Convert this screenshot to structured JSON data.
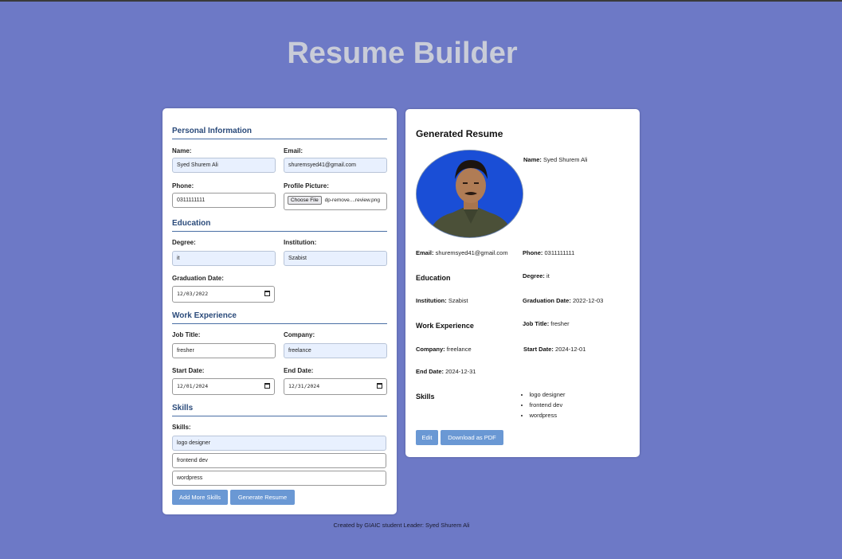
{
  "page": {
    "title": "Resume Builder",
    "footer": "Created by GIAIC student Leader: Syed Shurem Ali"
  },
  "form": {
    "personal": {
      "heading": "Personal Information",
      "name_label": "Name:",
      "name_value": "Syed Shurem Ali",
      "email_label": "Email:",
      "email_value": "shuremsyed41@gmail.com",
      "phone_label": "Phone:",
      "phone_value": "0311111111",
      "picture_label": "Profile Picture:",
      "choose_file": "Choose File",
      "file_name": "dp-remove....review.png"
    },
    "education": {
      "heading": "Education",
      "degree_label": "Degree:",
      "degree_value": "it",
      "institution_label": "Institution:",
      "institution_value": "Szabist",
      "grad_label": "Graduation Date:",
      "grad_value": "12/03/2022"
    },
    "work": {
      "heading": "Work Experience",
      "job_label": "Job Title:",
      "job_value": "fresher",
      "company_label": "Company:",
      "company_value": "freelance",
      "start_label": "Start Date:",
      "start_value": "12/01/2024",
      "end_label": "End Date:",
      "end_value": "12/31/2024"
    },
    "skills": {
      "heading": "Skills",
      "label": "Skills:",
      "values": [
        "logo designer",
        "frontend dev",
        "wordpress"
      ]
    },
    "buttons": {
      "add_skills": "Add More Skills",
      "generate": "Generate Resume"
    }
  },
  "resume": {
    "title": "Generated Resume",
    "name_label": "Name:",
    "name": "Syed Shurem Ali",
    "email_label": "Email:",
    "email": "shuremsyed41@gmail.com",
    "phone_label": "Phone:",
    "phone": "0311111111",
    "education_heading": "Education",
    "degree_label": "Degree:",
    "degree": "it",
    "institution_label": "Institution:",
    "institution": "Szabist",
    "grad_label": "Graduation Date:",
    "grad": "2022-12-03",
    "work_heading": "Work Experience",
    "job_label": "Job Title:",
    "job": "fresher",
    "company_label": "Company:",
    "company": "freelance",
    "start_label": "Start Date:",
    "start": "2024-12-01",
    "end_label": "End Date:",
    "end": "2024-12-31",
    "skills_heading": "Skills",
    "skills": [
      "logo designer",
      "frontend dev",
      "wordpress"
    ],
    "edit_button": "Edit",
    "download_button": "Download as PDF"
  },
  "colors": {
    "background": "#6d79c6",
    "accent": "#6a98d4",
    "heading": "#2a4a7a"
  }
}
